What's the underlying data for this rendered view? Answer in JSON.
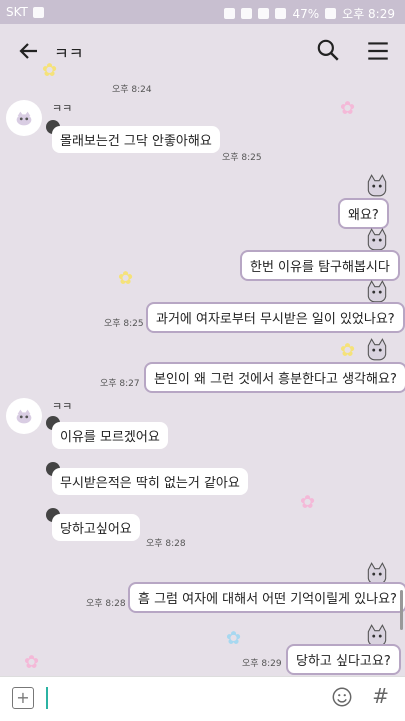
{
  "statusbar": {
    "carrier": "SKT",
    "battery": "47%",
    "time": "오후 8:29"
  },
  "header": {
    "title": "ㅋㅋ"
  },
  "messages": {
    "t1": "오후 8:24",
    "sender1": "ㅋㅋ",
    "in1": "몰래보는건 그닥 안좋아해요",
    "t2": "오후 8:25",
    "out1": "왜요?",
    "out2": "한번 이유를 탐구해봅시다",
    "t3": "오후 8:25",
    "out3": "과거에 여자로부터 무시받은 일이 있었나요?",
    "t4": "오후 8:27",
    "out4": "본인이 왜 그런 것에서 흥분한다고 생각해요?",
    "sender2": "ㅋㅋ",
    "in2": "이유를 모르겠어요",
    "in3": "무시받은적은 딱히 없는거 같아요",
    "in4": "당하고싶어요",
    "t5": "오후 8:28",
    "t6": "오후 8:28",
    "out5": "흠 그럼 여자에 대해서 어떤 기억이릴게 있나요?",
    "t7": "오후 8:29",
    "out6": "당하고 싶다고요?"
  },
  "icons": {
    "back": "arrow-left-icon",
    "search": "search-icon",
    "menu": "menu-icon",
    "plus": "plus-icon",
    "emoji": "emoji-icon",
    "hash": "hash-icon"
  },
  "colors": {
    "background": "#e6e0e8",
    "statusbar": "#c8bfd0",
    "bubble_border": "#b7a6c4",
    "cursor": "#2bb3a3"
  }
}
